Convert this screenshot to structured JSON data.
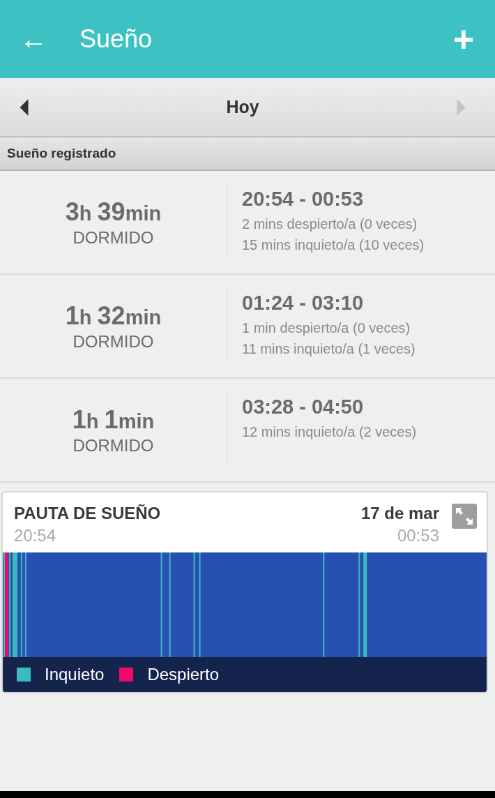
{
  "app_bar": {
    "title": "Sueño",
    "back_icon": "←",
    "add_icon": "+"
  },
  "date_nav": {
    "label": "Hoy",
    "prev_disabled": false,
    "next_disabled": true
  },
  "section_header": "Sueño registrado",
  "sleep_logs": [
    {
      "duration": "3h 39min",
      "status": "DORMIDO",
      "time_range": "20:54 - 00:53",
      "details": [
        "2 mins despierto/a (0 veces)",
        "15 mins inquieto/a (10 veces)"
      ]
    },
    {
      "duration": "1h 32min",
      "status": "DORMIDO",
      "time_range": "01:24 - 03:10",
      "details": [
        "1 min despierto/a (0 veces)",
        "11 mins inquieto/a (1 veces)"
      ]
    },
    {
      "duration": "1h 1min",
      "status": "DORMIDO",
      "time_range": "03:28 - 04:50",
      "details": [
        "12 mins inquieto/a (2 veces)"
      ]
    }
  ],
  "sleep_pattern": {
    "title": "PAUTA DE SUEÑO",
    "date": "17 de mar",
    "start_time": "20:54",
    "end_time": "00:53",
    "legend": [
      {
        "label": "Inquieto",
        "color": "#38bcbc"
      },
      {
        "label": "Despierto",
        "color": "#f0086a"
      }
    ]
  }
}
